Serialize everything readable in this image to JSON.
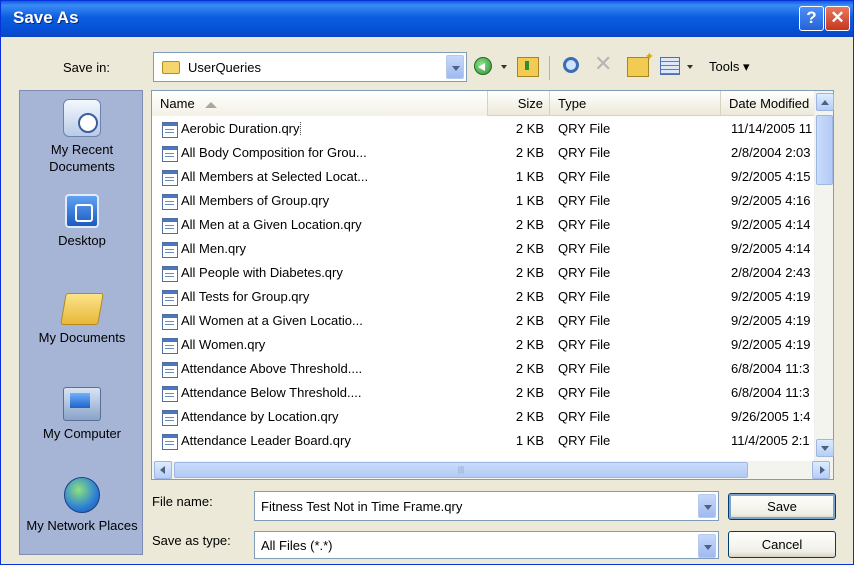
{
  "window": {
    "title": "Save As",
    "help_glyph": "?",
    "close_glyph": "✕",
    "titlebar_color": "#0a5fe0",
    "face_color": "#ece9d8"
  },
  "toolbar": {
    "save_in_label": "Save in:",
    "save_in_value": "UserQueries",
    "tools_label": "Tools ▾",
    "delete_glyph": "✕"
  },
  "places": [
    {
      "label": "My Recent Documents",
      "icon": "recent-documents-icon"
    },
    {
      "label": "Desktop",
      "icon": "desktop-icon"
    },
    {
      "label": "My Documents",
      "icon": "my-documents-icon"
    },
    {
      "label": "My Computer",
      "icon": "my-computer-icon"
    },
    {
      "label": "My Network Places",
      "icon": "network-places-icon"
    }
  ],
  "columns": {
    "name": "Name",
    "size": "Size",
    "type": "Type",
    "date": "Date Modified"
  },
  "files": [
    {
      "name": "Aerobic Duration.qry",
      "size": "2 KB",
      "type": "QRY File",
      "date": "11/14/2005 11"
    },
    {
      "name": "All Body Composition for Grou...",
      "size": "2 KB",
      "type": "QRY File",
      "date": "2/8/2004 2:03"
    },
    {
      "name": "All Members at Selected Locat...",
      "size": "1 KB",
      "type": "QRY File",
      "date": "9/2/2005 4:15"
    },
    {
      "name": "All Members of Group.qry",
      "size": "1 KB",
      "type": "QRY File",
      "date": "9/2/2005 4:16"
    },
    {
      "name": "All Men at a Given Location.qry",
      "size": "2 KB",
      "type": "QRY File",
      "date": "9/2/2005 4:14"
    },
    {
      "name": "All Men.qry",
      "size": "2 KB",
      "type": "QRY File",
      "date": "9/2/2005 4:14"
    },
    {
      "name": "All People with Diabetes.qry",
      "size": "2 KB",
      "type": "QRY File",
      "date": "2/8/2004 2:43"
    },
    {
      "name": "All Tests for Group.qry",
      "size": "2 KB",
      "type": "QRY File",
      "date": "9/2/2005 4:19"
    },
    {
      "name": "All Women at a Given Locatio...",
      "size": "2 KB",
      "type": "QRY File",
      "date": "9/2/2005 4:19"
    },
    {
      "name": "All Women.qry",
      "size": "2 KB",
      "type": "QRY File",
      "date": "9/2/2005 4:19"
    },
    {
      "name": "Attendance Above Threshold....",
      "size": "2 KB",
      "type": "QRY File",
      "date": "6/8/2004 11:3"
    },
    {
      "name": "Attendance Below Threshold....",
      "size": "2 KB",
      "type": "QRY File",
      "date": "6/8/2004 11:3"
    },
    {
      "name": "Attendance by Location.qry",
      "size": "2 KB",
      "type": "QRY File",
      "date": "9/26/2005 1:4"
    },
    {
      "name": "Attendance Leader Board.qry",
      "size": "1 KB",
      "type": "QRY File",
      "date": "11/4/2005 2:1"
    }
  ],
  "scrollbar": {
    "grip": "|||"
  },
  "footer": {
    "file_name_label": "File name:",
    "file_name_value": "Fitness Test Not in Time Frame.qry",
    "save_type_label": "Save as type:",
    "save_type_value": "All Files (*.*)",
    "save_button": "Save",
    "cancel_button": "Cancel"
  }
}
